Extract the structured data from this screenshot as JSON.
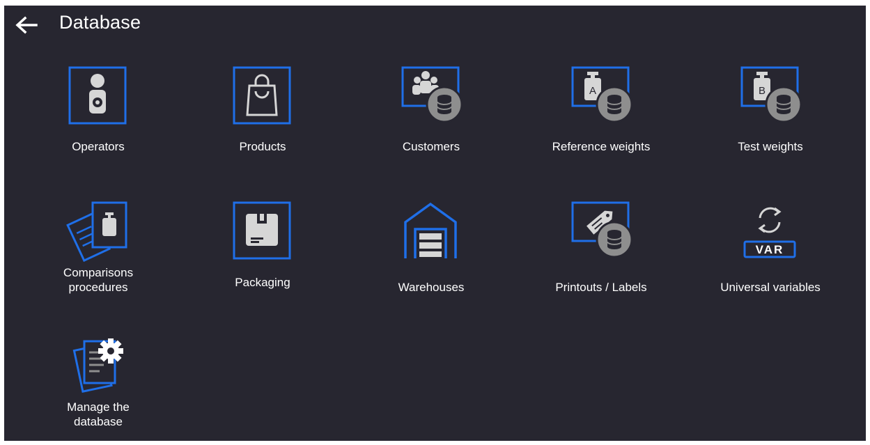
{
  "header": {
    "title": "Database",
    "back_icon": "arrow-left-icon"
  },
  "colors": {
    "background": "#272630",
    "accent": "#1f6fe8",
    "icon_fill": "#d6d6d6",
    "badge": "#8e8e8e"
  },
  "tiles": [
    {
      "label": "Operators",
      "icon": "operator-icon"
    },
    {
      "label": "Products",
      "icon": "shopping-bag-icon"
    },
    {
      "label": "Customers",
      "icon": "customers-database-icon"
    },
    {
      "label": "Reference weights",
      "icon": "weight-a-database-icon",
      "icon_text": "A"
    },
    {
      "label": "Test weights",
      "icon": "weight-b-database-icon",
      "icon_text": "B"
    },
    {
      "label": "Comparisons\nprocedures",
      "icon": "comparison-documents-icon"
    },
    {
      "label": "Packaging",
      "icon": "package-icon"
    },
    {
      "label": "Warehouses",
      "icon": "warehouse-icon"
    },
    {
      "label": "Printouts / Labels",
      "icon": "label-tag-database-icon"
    },
    {
      "label": "Universal variables",
      "icon": "var-refresh-icon",
      "icon_text": "VAR"
    },
    {
      "label": "Manage the\ndatabase",
      "icon": "documents-gear-icon"
    }
  ]
}
